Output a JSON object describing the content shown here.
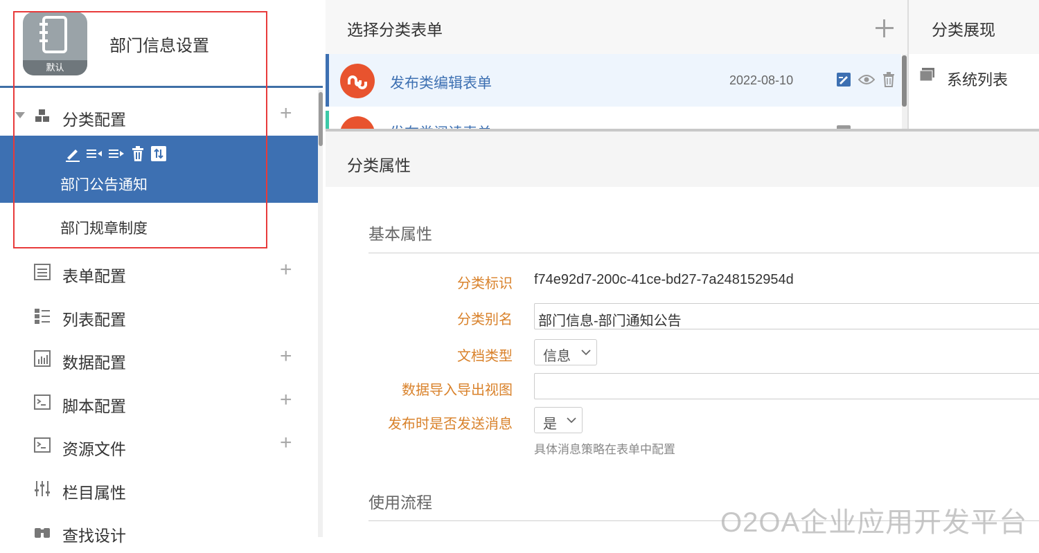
{
  "sidebar": {
    "app_badge": "默认",
    "app_title": "部门信息设置",
    "category_config": {
      "label": "分类配置",
      "children": [
        {
          "label": "部门公告通知",
          "selected": true
        },
        {
          "label": "部门规章制度",
          "selected": false
        }
      ]
    },
    "items": [
      {
        "label": "表单配置",
        "icon": "form-icon",
        "has_add": true
      },
      {
        "label": "列表配置",
        "icon": "list-icon",
        "has_add": false
      },
      {
        "label": "数据配置",
        "icon": "chart-icon",
        "has_add": true
      },
      {
        "label": "脚本配置",
        "icon": "script-icon",
        "has_add": true
      },
      {
        "label": "资源文件",
        "icon": "resource-icon",
        "has_add": true
      },
      {
        "label": "栏目属性",
        "icon": "sliders-icon",
        "has_add": false
      },
      {
        "label": "查找设计",
        "icon": "binoculars-icon",
        "has_add": false
      }
    ],
    "add_symbol": "+"
  },
  "form_panel": {
    "title": "选择分类表单",
    "add_symbol": "+",
    "rows": [
      {
        "name": "发布类编辑表单",
        "date": "2022-08-10"
      },
      {
        "name": "发布类阅读表单",
        "date": ""
      }
    ]
  },
  "view_panel": {
    "title": "分类展现",
    "items": [
      {
        "label": "系统列表"
      }
    ]
  },
  "properties": {
    "title": "分类属性",
    "section_basic": "基本属性",
    "fields": {
      "id_label": "分类标识",
      "id_value": "f74e92d7-200c-41ce-bd27-7a248152954d",
      "alias_label": "分类别名",
      "alias_value": "部门信息-部门通知公告",
      "doctype_label": "文档类型",
      "doctype_value": "信息",
      "import_label": "数据导入导出视图",
      "import_value": "",
      "notify_label": "发布时是否发送消息",
      "notify_value": "是",
      "notify_hint": "具体消息策略在表单中配置"
    },
    "section_flow": "使用流程"
  },
  "watermark": "O2OA企业应用开发平台",
  "colors": {
    "accent": "#3d70b2",
    "label_orange": "#d9822b",
    "highlight_border": "#e83a3a"
  }
}
